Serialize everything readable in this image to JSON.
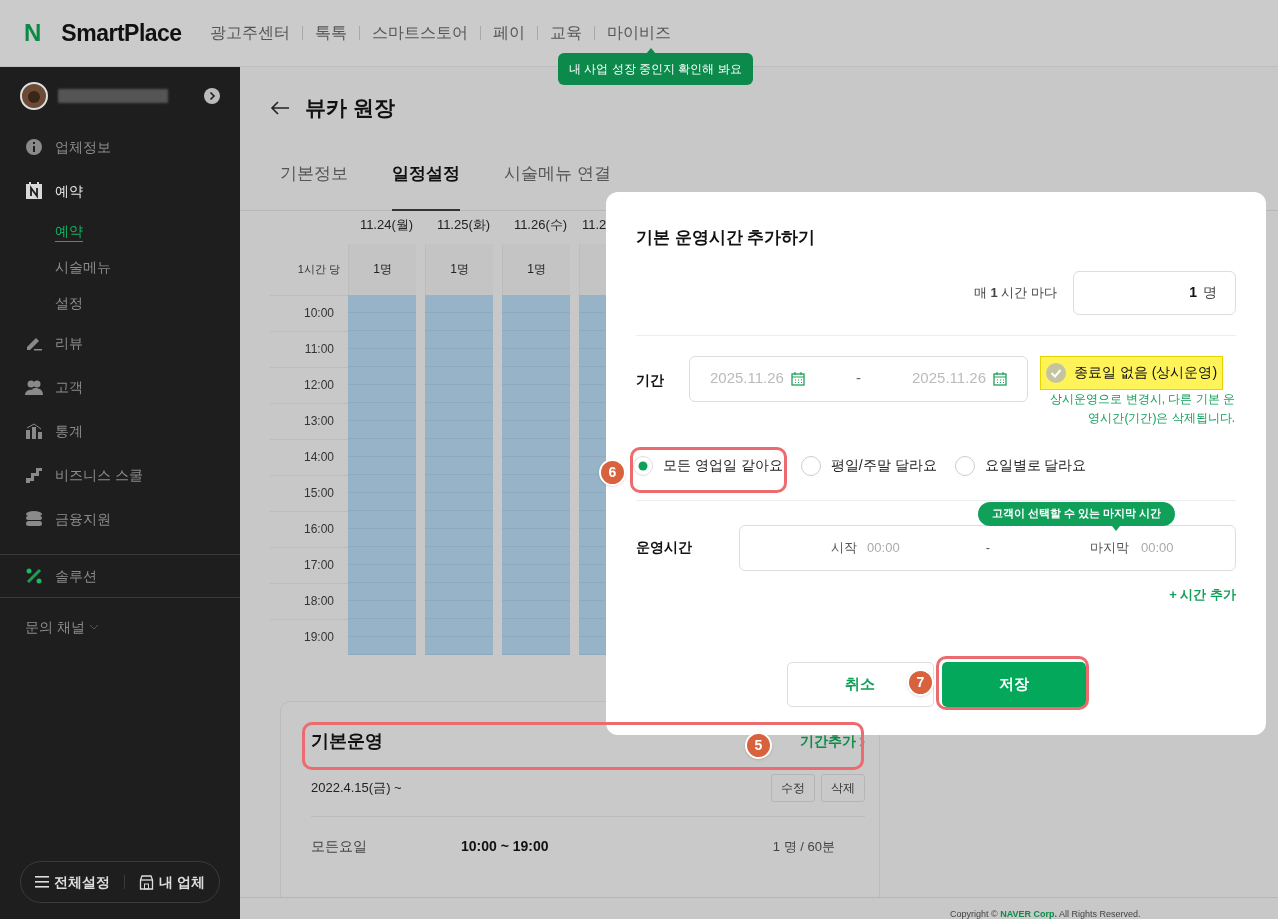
{
  "header": {
    "logo_mark": "N",
    "logo_text": "SmartPlace",
    "nav": [
      "광고주센터",
      "톡톡",
      "스마트스토어",
      "페이",
      "교육",
      "마이비즈"
    ],
    "tooltip": "내 사업 성장 중인지 확인해 봐요"
  },
  "sidebar": {
    "items": [
      {
        "label": "업체정보",
        "selected": false
      },
      {
        "label": "예약",
        "selected": true,
        "children": [
          {
            "label": "예약",
            "selected": true
          },
          {
            "label": "시술메뉴",
            "selected": false
          },
          {
            "label": "설정",
            "selected": false
          }
        ]
      },
      {
        "label": "리뷰",
        "selected": false
      },
      {
        "label": "고객",
        "selected": false
      },
      {
        "label": "통계",
        "selected": false
      },
      {
        "label": "비즈니스 스쿨",
        "selected": false
      },
      {
        "label": "금융지원",
        "selected": false
      }
    ],
    "solution": "솔루션",
    "inquiry": "문의 채널",
    "bottom_buttons": [
      "전체설정",
      "내 업체"
    ]
  },
  "page": {
    "title": "뷰카 원장",
    "tabs": [
      {
        "label": "기본정보",
        "selected": false
      },
      {
        "label": "일정설정",
        "selected": true
      },
      {
        "label": "시술메뉴 연결",
        "selected": false
      }
    ]
  },
  "schedule": {
    "dates": [
      "11.24(월)",
      "11.25(화)",
      "11.26(수)",
      "11.2"
    ],
    "per_hour_label": "1시간 당",
    "capacities": [
      "1명",
      "1명",
      "1명"
    ],
    "times": [
      "10:00",
      "11:00",
      "12:00",
      "13:00",
      "14:00",
      "15:00",
      "16:00",
      "17:00",
      "18:00",
      "19:00"
    ]
  },
  "basic_card": {
    "title": "기본운영",
    "link": "기간추가",
    "period": "2022.4.15(금) ~",
    "buttons": [
      "수정",
      "삭제"
    ],
    "row": {
      "day": "모든요일",
      "hours": "10:00 ~ 19:00",
      "capacity": "1 명 / 60분"
    }
  },
  "footer": {
    "copyright": "Copyright © **NAVER Corp.** All Rights Reserved."
  },
  "modal": {
    "title": "기본 운영시간 추가하기",
    "capacity": {
      "label": "매 **1** 시간 마다",
      "value": "1",
      "unit": "명"
    },
    "period": {
      "label": "기간",
      "start": "2025.11.26",
      "separator": "-",
      "end": "2025.11.26",
      "no_end": {
        "label": "종료일 없음 (상시운영)",
        "checked": false,
        "highlighted": true
      },
      "note": "상시운영으로 변경시, 다른 기본 운영시간(기간)은 삭제됩니다."
    },
    "day_options": [
      {
        "label": "모든 영업일 같아요",
        "selected": true
      },
      {
        "label": "평일/주말 달라요",
        "selected": false
      },
      {
        "label": "요일별로 달라요",
        "selected": false
      }
    ],
    "hours": {
      "label": "운영시간",
      "tooltip": "고객이 선택할 수 있는 마지막 시간",
      "start_label": "시작",
      "start_placeholder": "00:00",
      "separator": "-",
      "end_label": "마지막",
      "end_placeholder": "00:00"
    },
    "add_time": "+ 시간 추가",
    "cancel": "취소",
    "save": "저장"
  },
  "annotations": [
    {
      "number": "5"
    },
    {
      "number": "6"
    },
    {
      "number": "7"
    }
  ]
}
